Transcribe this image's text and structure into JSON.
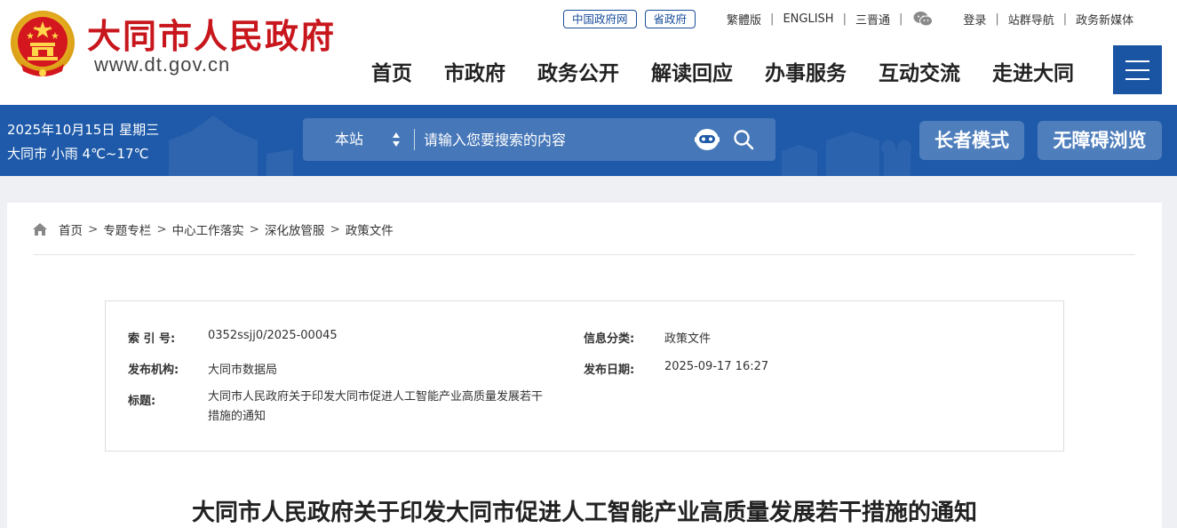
{
  "header": {
    "title": "大同市人民政府",
    "url": "www.dt.gov.cn",
    "top_pills": [
      "中国政府网",
      "省政府"
    ],
    "top_links": [
      "繁體版",
      "ENGLISH",
      "三晋通"
    ],
    "account_links": [
      "登录",
      "站群导航",
      "政务新媒体"
    ],
    "nav": [
      "首页",
      "市政府",
      "政务公开",
      "解读回应",
      "办事服务",
      "互动交流",
      "走进大同"
    ]
  },
  "band": {
    "date": "2025年10月15日 星期三",
    "weather": "大同市 小雨 4℃~17℃",
    "search_scope": "本站",
    "search_placeholder": "请输入您要搜索的内容",
    "elder_mode": "长者模式",
    "accessible": "无障碍浏览"
  },
  "breadcrumb": [
    "首页",
    "专题专栏",
    "中心工作落实",
    "深化放管服",
    "政策文件"
  ],
  "info": {
    "index_label": "索 引 号:",
    "index_value": "0352ssjj0/2025-00045",
    "category_label": "信息分类:",
    "category_value": "政策文件",
    "org_label": "发布机构:",
    "org_value": "大同市数据局",
    "date_label": "发布日期:",
    "date_value": "2025-09-17 16:27",
    "title_label": "标题:",
    "title_value": "大同市人民政府关于印发大同市促进人工智能产业高质量发展若干措施的通知"
  },
  "document": {
    "title": "大同市人民政府关于印发大同市促进人工智能产业高质量发展若干措施的通知"
  },
  "colors": {
    "brand_red": "#c8161d",
    "brand_blue": "#1a55a3"
  }
}
